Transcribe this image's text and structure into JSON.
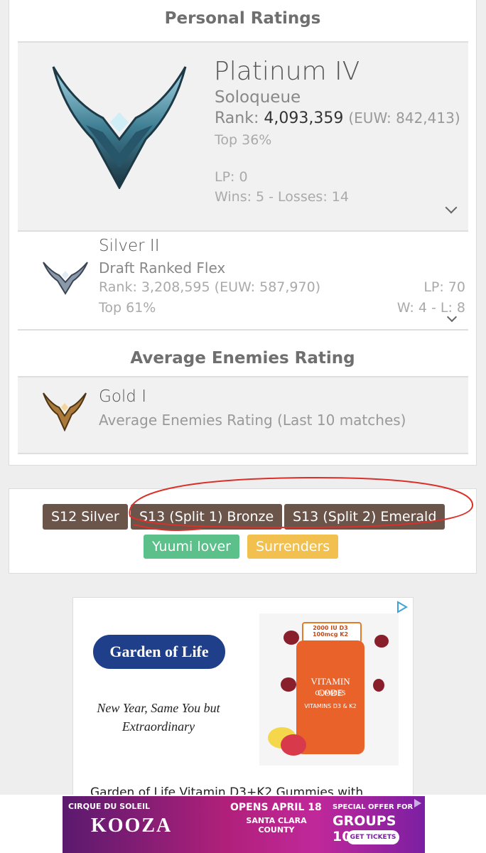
{
  "ratings": {
    "section_title": "Personal Ratings",
    "soloqueue": {
      "tier": "Platinum IV",
      "queue": "Soloqueue",
      "rank_label": "Rank:",
      "rank_value": "4,093,359",
      "region_rank": "(EUW: 842,413)",
      "top": "Top 36%",
      "lp": "LP: 0",
      "record": "Wins: 5 - Losses: 14"
    },
    "flex": {
      "tier": "Silver II",
      "queue": "Draft Ranked Flex",
      "rank": "Rank: 3,208,595",
      "region_rank": "(EUW: 587,970)",
      "top": "Top 61%",
      "lp": "LP: 70",
      "record": "W: 4 - L: 8"
    },
    "avg_title": "Average Enemies Rating",
    "avg": {
      "tier": "Gold I",
      "desc": "Average Enemies Rating (Last 10 matches)"
    }
  },
  "tags": [
    {
      "label": "S12 Silver",
      "color": "#6b544a"
    },
    {
      "label": "S13 (Split 1) Bronze",
      "color": "#6b544a"
    },
    {
      "label": "S13 (Split 2) Emerald",
      "color": "#6b544a"
    },
    {
      "label": "Yuumi lover",
      "color": "#5cc08a"
    },
    {
      "label": "Surrenders",
      "color": "#f2c04f"
    }
  ],
  "ad": {
    "brand": "Garden of Life",
    "slogan": "New Year, Same You but Extraordinary",
    "product_top": "2000 IU D3 100mcg K2",
    "product_name": "VITAMIN CODE",
    "product_sub": "GUMMIES",
    "product_vit": "VITAMINS D3 & K2",
    "headline": "Garden of Life Vitamin D3+K2 Gummies with"
  },
  "banner": {
    "brand": "CIRQUE DU SOLEIL",
    "show": "KOOZA",
    "opens": "OPENS APRIL 18",
    "place": "SANTA CLARA COUNTY",
    "offer": "SPECIAL OFFER FOR",
    "groups": "GROUPS 10+",
    "cta": "GET TICKETS"
  },
  "colors": {
    "tag_brown": "#6b544a",
    "tag_green": "#5cc08a",
    "tag_yellow": "#f2c04f",
    "annotation_red": "#d9302a"
  }
}
